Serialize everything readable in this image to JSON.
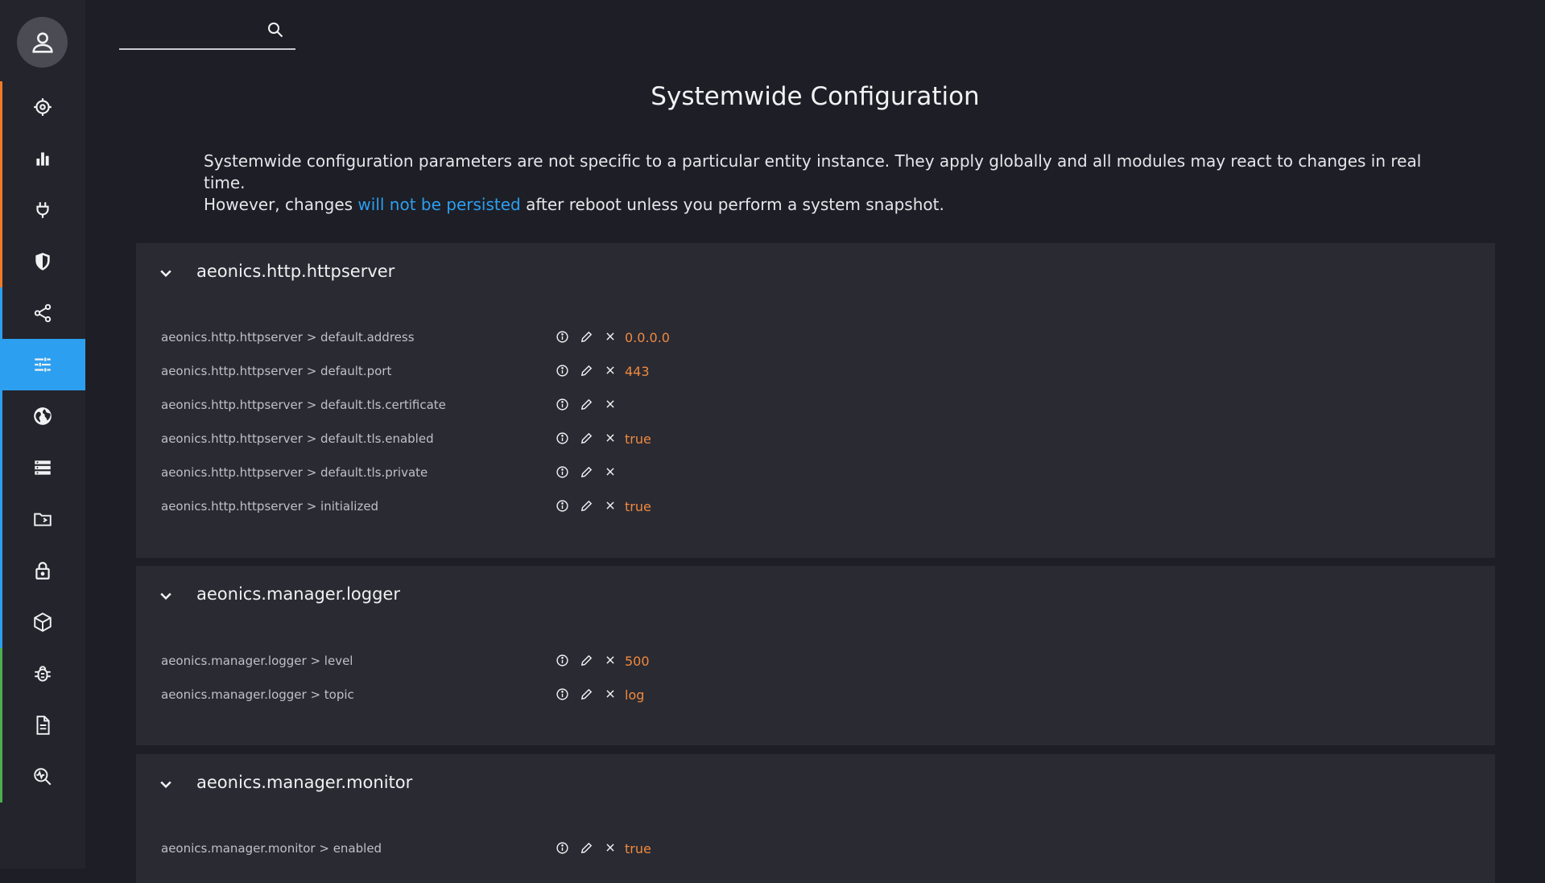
{
  "search": {
    "placeholder": "",
    "value": ""
  },
  "page": {
    "title": "Systemwide Configuration",
    "description_line1": "Systemwide configuration parameters are not specific to a particular entity instance. They apply globally and all modules may react to changes in real time.",
    "description_line2_before": "However, changes ",
    "description_link": "will not be persisted",
    "description_line2_after": " after reboot unless you perform a system snapshot."
  },
  "sidebar": {
    "items": [
      {
        "icon": "target-icon",
        "accent": "#f07a2a",
        "active": false
      },
      {
        "icon": "bar-chart-icon",
        "accent": "#f07a2a",
        "active": false
      },
      {
        "icon": "plug-icon",
        "accent": "#f07a2a",
        "active": false
      },
      {
        "icon": "shield-icon",
        "accent": "#f07a2a",
        "active": false
      },
      {
        "icon": "share-icon",
        "accent": "#2c9ff0",
        "active": false
      },
      {
        "icon": "sliders-icon",
        "accent": "#2c9ff0",
        "active": true
      },
      {
        "icon": "globe-icon",
        "accent": "#2c9ff0",
        "active": false
      },
      {
        "icon": "server-icon",
        "accent": "#2c9ff0",
        "active": false
      },
      {
        "icon": "folder-icon",
        "accent": "#2c9ff0",
        "active": false
      },
      {
        "icon": "lock-icon",
        "accent": "#2c9ff0",
        "active": false
      },
      {
        "icon": "cube-icon",
        "accent": "#2c9ff0",
        "active": false
      },
      {
        "icon": "bug-icon",
        "accent": "#4caf50",
        "active": false
      },
      {
        "icon": "document-icon",
        "accent": "#4caf50",
        "active": false
      },
      {
        "icon": "monitor-search-icon",
        "accent": "#4caf50",
        "active": false
      }
    ]
  },
  "sections": [
    {
      "title": "aeonics.http.httpserver",
      "rows": [
        {
          "key": "aeonics.http.httpserver > default.address",
          "value": "0.0.0.0"
        },
        {
          "key": "aeonics.http.httpserver > default.port",
          "value": "443"
        },
        {
          "key": "aeonics.http.httpserver > default.tls.certificate",
          "value": ""
        },
        {
          "key": "aeonics.http.httpserver > default.tls.enabled",
          "value": "true"
        },
        {
          "key": "aeonics.http.httpserver > default.tls.private",
          "value": ""
        },
        {
          "key": "aeonics.http.httpserver > initialized",
          "value": "true"
        }
      ]
    },
    {
      "title": "aeonics.manager.logger",
      "rows": [
        {
          "key": "aeonics.manager.logger > level",
          "value": "500"
        },
        {
          "key": "aeonics.manager.logger > topic",
          "value": "log"
        }
      ]
    },
    {
      "title": "aeonics.manager.monitor",
      "rows": [
        {
          "key": "aeonics.manager.monitor > enabled",
          "value": "true"
        }
      ]
    }
  ],
  "colors": {
    "background": "#1d1e26",
    "panel": "#2a2a33",
    "accent_blue": "#2c9ff0",
    "value_orange": "#f08a3c"
  }
}
